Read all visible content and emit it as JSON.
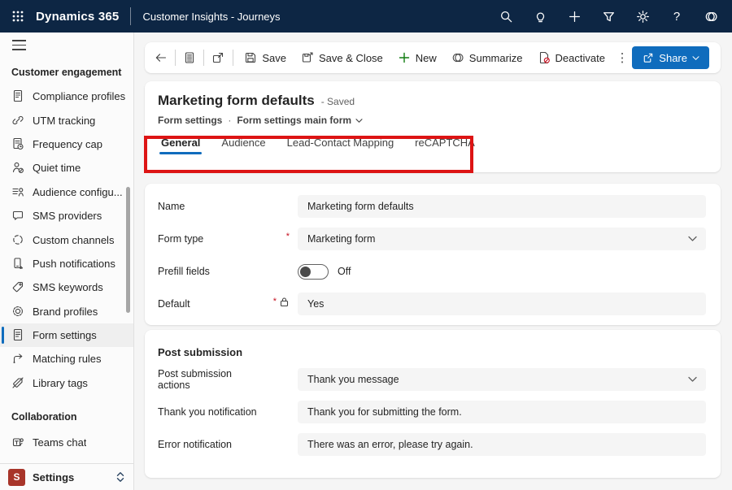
{
  "topbar": {
    "brand": "Dynamics 365",
    "app_name": "Customer Insights - Journeys",
    "icons": [
      "app-launcher-waffle",
      "search",
      "lightbulb",
      "add",
      "filter",
      "settings-gear",
      "help",
      "copilot"
    ],
    "help_glyph": "?",
    "navbar_color": "#0d2644"
  },
  "sidebar": {
    "section1_header": "Customer engagement",
    "items": [
      {
        "label": "Compliance profiles",
        "icon": "compliance-document",
        "selected": false
      },
      {
        "label": "UTM tracking",
        "icon": "link",
        "selected": false
      },
      {
        "label": "Frequency cap",
        "icon": "document-clock",
        "selected": false
      },
      {
        "label": "Quiet time",
        "icon": "person-mute",
        "selected": false
      },
      {
        "label": "Audience configu...",
        "icon": "audience-list",
        "selected": false
      },
      {
        "label": "SMS providers",
        "icon": "chat-bubble",
        "selected": false
      },
      {
        "label": "Custom channels",
        "icon": "channels",
        "selected": false
      },
      {
        "label": "Push notifications",
        "icon": "phone-edit",
        "selected": false
      },
      {
        "label": "SMS keywords",
        "icon": "tag",
        "selected": false
      },
      {
        "label": "Brand profiles",
        "icon": "badge-seal",
        "selected": false
      },
      {
        "label": "Form settings",
        "icon": "form-page",
        "selected": true
      },
      {
        "label": "Matching rules",
        "icon": "branch-arrow",
        "selected": false
      },
      {
        "label": "Library tags",
        "icon": "tag-slash",
        "selected": false
      }
    ],
    "section2_header": "Collaboration",
    "items2": [
      {
        "label": "Teams chat",
        "icon": "teams",
        "selected": false
      }
    ],
    "footer": {
      "badge": "S",
      "label": "Settings",
      "badge_color": "#a8352a",
      "icon": "unfold-chevrons"
    }
  },
  "toolbar": {
    "back_icon": "back-arrow",
    "record_icon": "record-list",
    "popout_icon": "popout",
    "save_label": "Save",
    "save_close_label": "Save & Close",
    "new_label": "New",
    "new_plus_color": "#107c10",
    "summarize_label": "Summarize",
    "deactivate_label": "Deactivate",
    "more_glyph": "⋮",
    "share_label": "Share",
    "share_color": "#0f6cbd"
  },
  "header": {
    "title": "Marketing form defaults",
    "status": "- Saved",
    "breadcrumb_1": "Form settings",
    "breadcrumb_sep": "·",
    "breadcrumb_2": "Form settings main form",
    "tabs": [
      {
        "label": "General",
        "active": true
      },
      {
        "label": "Audience",
        "active": false
      },
      {
        "label": "Lead-Contact Mapping",
        "active": false
      },
      {
        "label": "reCAPTCHA",
        "active": false
      }
    ],
    "annotation": {
      "type": "red-highlight-box",
      "color": "#dd1414",
      "around": "tabs"
    }
  },
  "form": {
    "required_marker": "*",
    "fields": [
      {
        "label": "Name",
        "value": "Marketing form defaults",
        "type": "text",
        "required": false,
        "locked": false
      },
      {
        "label": "Form type",
        "value": "Marketing form",
        "type": "select",
        "required": true,
        "locked": false
      },
      {
        "label": "Prefill fields",
        "value": "Off",
        "type": "toggle",
        "state": "off",
        "required": false,
        "locked": false
      },
      {
        "label": "Default",
        "value": "Yes",
        "type": "text",
        "required": true,
        "locked": true
      }
    ]
  },
  "post_submission": {
    "section_title": "Post submission",
    "fields": [
      {
        "label": "Post submission actions",
        "value": "Thank you message",
        "type": "select"
      },
      {
        "label": "Thank you notification",
        "value": "Thank you for submitting the form.",
        "type": "text"
      },
      {
        "label": "Error notification",
        "value": "There was an error, please try again.",
        "type": "text"
      }
    ]
  },
  "colors": {
    "accent_blue": "#0f6cbd",
    "required_red": "#c50f1f",
    "field_bg": "#f5f5f5"
  }
}
